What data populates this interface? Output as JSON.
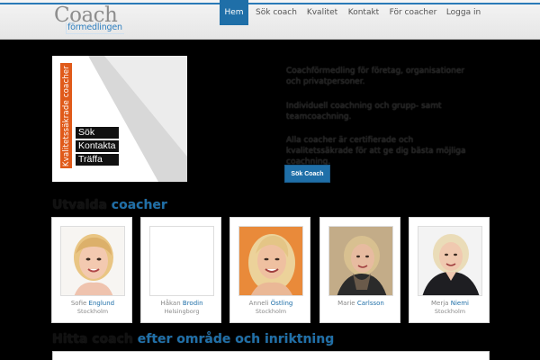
{
  "logo": {
    "title": "Coach",
    "subtitle": "förmedlingen"
  },
  "nav": [
    {
      "label": "Hem",
      "active": true
    },
    {
      "label": "Sök coach",
      "active": false
    },
    {
      "label": "Kvalitet",
      "active": false
    },
    {
      "label": "Kontakt",
      "active": false
    },
    {
      "label": "För coacher",
      "active": false
    },
    {
      "label": "Logga in",
      "active": false
    }
  ],
  "hero": {
    "vertical_label": "Kvalitetssäkrade coacher",
    "words": [
      "Sök",
      "Kontakta",
      "Träffa"
    ],
    "paragraphs": [
      "Coachförmedling för företag, organisationer och privatpersoner.",
      "Individuell coachning och grupp- samt teamcoachning.",
      "Alla coacher är certifierade och kvalitetssäkrade för att ge dig bästa möjliga coachning."
    ],
    "button": "Sök Coach"
  },
  "featured": {
    "title": "Utvalda",
    "title_blue": "coacher"
  },
  "coaches": [
    {
      "first": "Sofie",
      "last": "Englund",
      "city": "Stockholm",
      "photo": "woman-smiling-short-blond-hair"
    },
    {
      "first": "Håkan",
      "last": "Brodin",
      "city": "Helsingborg",
      "photo": "no-photo-placeholder"
    },
    {
      "first": "Anneli",
      "last": "Östling",
      "city": "Stockholm",
      "photo": "woman-smiling-long-blond-hair"
    },
    {
      "first": "Marie",
      "last": "Carlsson",
      "city": "",
      "photo": "woman-blond-dark-scarf"
    },
    {
      "first": "Merja",
      "last": "Niemi",
      "city": "Stockholm",
      "photo": "woman-blond-dark-jacket"
    }
  ],
  "section2": {
    "title": "Hitta coach",
    "title_blue": "efter område och inriktning"
  }
}
